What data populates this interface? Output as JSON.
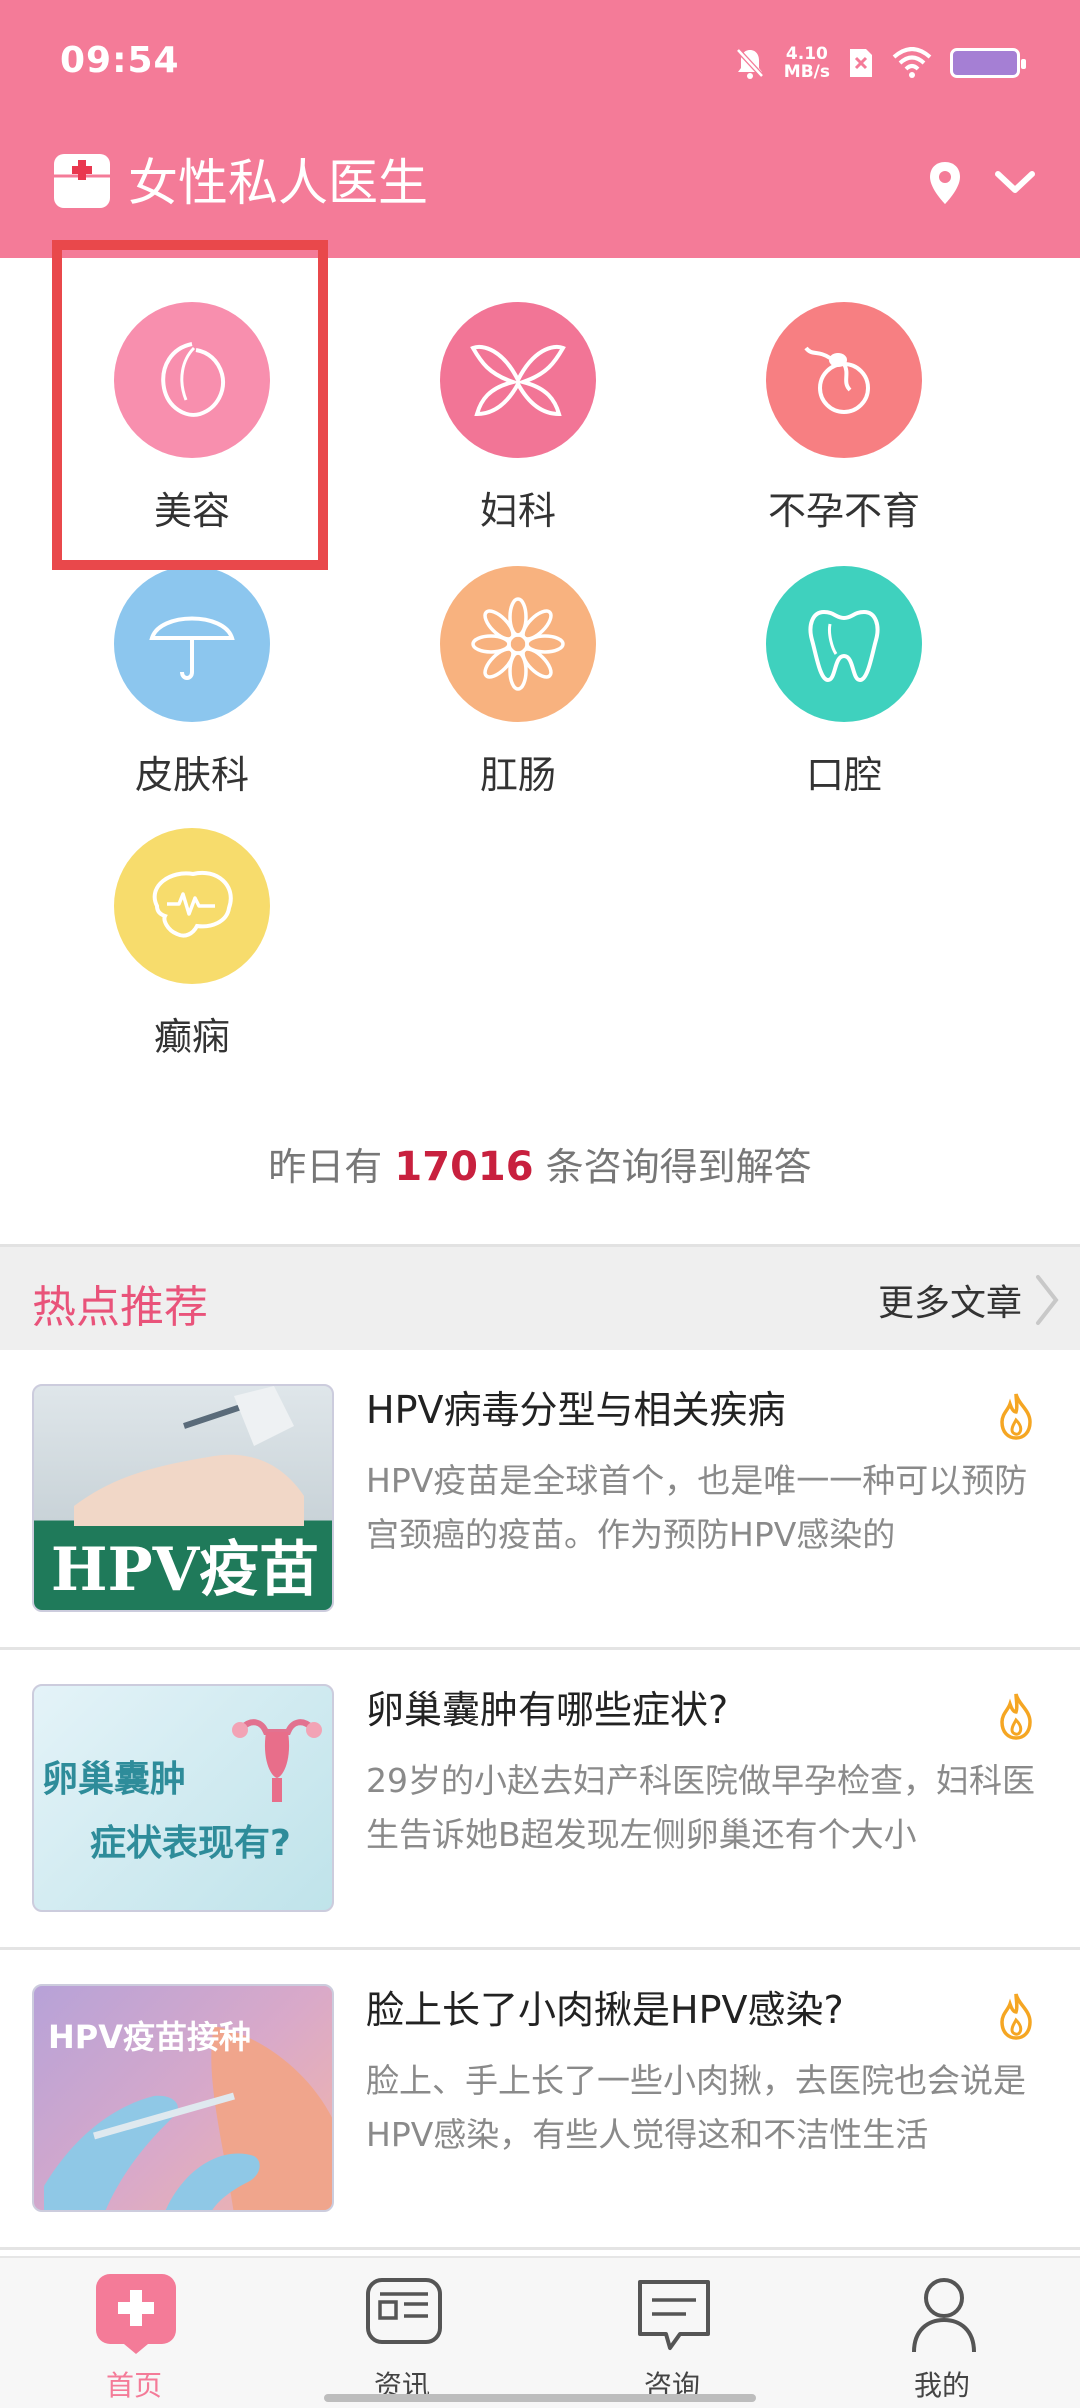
{
  "status_bar": {
    "time": "09:54",
    "net_speed_value": "4.10",
    "net_speed_unit": "MB/s"
  },
  "header": {
    "title": "女性私人医生"
  },
  "categories": [
    {
      "label": "美容",
      "color": "#f88fae",
      "icon": "peach-icon"
    },
    {
      "label": "妇科",
      "color": "#f27596",
      "icon": "butterfly-icon"
    },
    {
      "label": "不孕不育",
      "color": "#f77f82",
      "icon": "sperm-icon"
    },
    {
      "label": "皮肤科",
      "color": "#8cc6ee",
      "icon": "umbrella-icon"
    },
    {
      "label": "肛肠",
      "color": "#f8b27f",
      "icon": "flower-icon"
    },
    {
      "label": "口腔",
      "color": "#3fd1be",
      "icon": "tooth-icon"
    },
    {
      "label": "癫痫",
      "color": "#f7dc6c",
      "icon": "brain-icon"
    }
  ],
  "stats": {
    "prefix": "昨日有",
    "count": "17016",
    "suffix": "条咨询得到解答"
  },
  "hot": {
    "title": "热点推荐",
    "more": "更多文章"
  },
  "articles": [
    {
      "title": "HPV病毒分型与相关疾病",
      "excerpt": "HPV疫苗是全球首个，也是唯一一种可以预防宫颈癌的疫苗。作为预防HPV感染的",
      "thumb_text": "HPV疫苗"
    },
    {
      "title": "卵巢囊肿有哪些症状?",
      "excerpt": "29岁的小赵去妇产科医院做早孕检查，妇科医生告诉她B超发现左侧卵巢还有个大小",
      "thumb_line1": "卵巢囊肿",
      "thumb_line2": "症状表现有?"
    },
    {
      "title": "脸上长了小肉揪是HPV感染?",
      "excerpt": "脸上、手上长了一些小肉揪，去医院也会说是HPV感染，有些人觉得这和不洁性生活",
      "thumb_text": "HPV疫苗接种"
    }
  ],
  "nav": [
    {
      "label": "首页",
      "active": true
    },
    {
      "label": "资讯",
      "active": false
    },
    {
      "label": "咨询",
      "active": false
    },
    {
      "label": "我的",
      "active": false
    }
  ],
  "colors": {
    "brand": "#f47b98",
    "highlight": "#e9484b",
    "count": "#c8203e",
    "hot": "#e9537a",
    "fire": "#f5a623"
  }
}
